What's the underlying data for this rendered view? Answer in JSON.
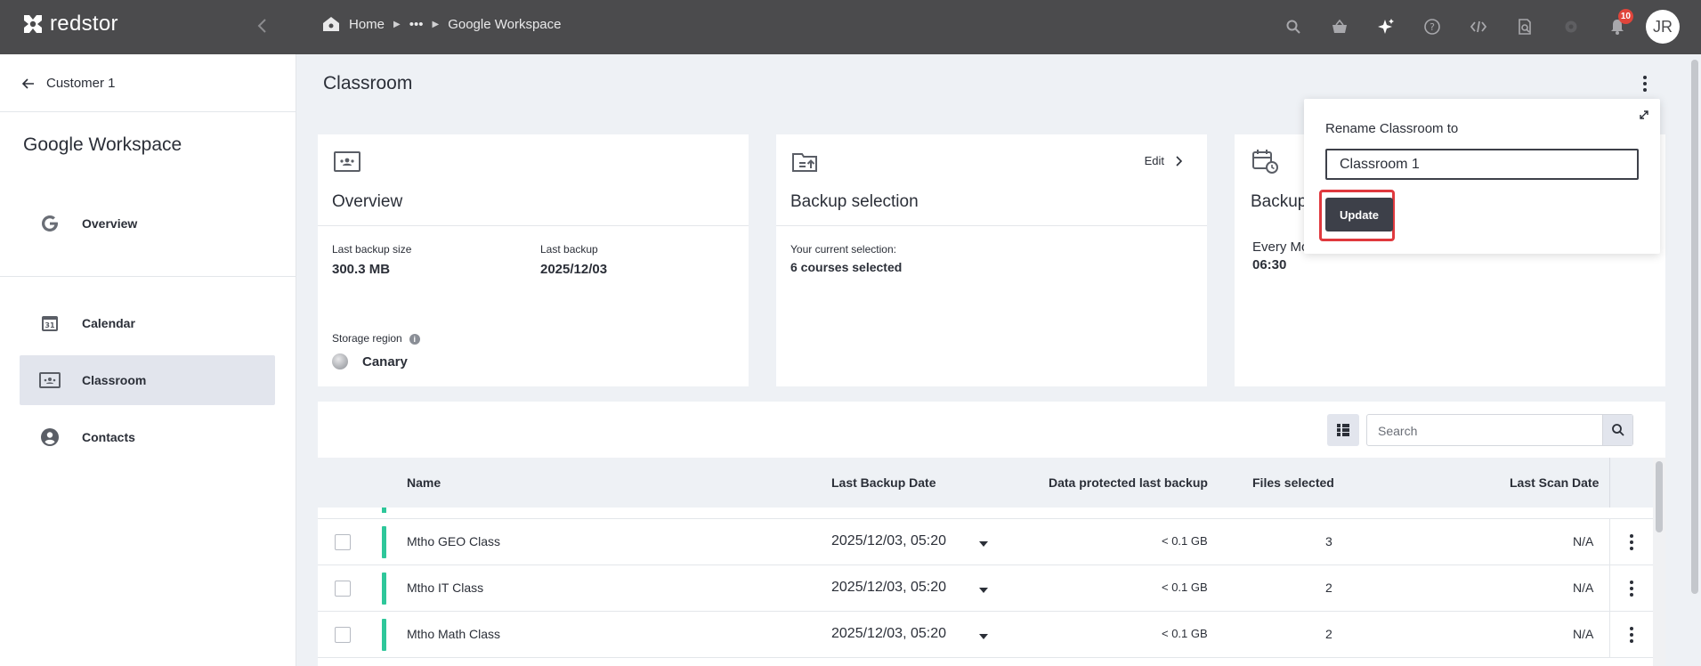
{
  "app": {
    "logo_text": "redstor"
  },
  "breadcrumb": {
    "home": "Home",
    "ellipsis": "•••",
    "current": "Google Workspace"
  },
  "topbar": {
    "notification_count": "10",
    "avatar_initials": "JR"
  },
  "sidebar": {
    "back_label": "Customer 1",
    "section_title": "Google Workspace",
    "items": [
      {
        "label": "Overview",
        "icon": "google-icon"
      },
      {
        "label": "Calendar",
        "icon": "calendar-icon"
      },
      {
        "label": "Classroom",
        "icon": "classroom-icon",
        "active": true
      },
      {
        "label": "Contacts",
        "icon": "contacts-icon"
      }
    ]
  },
  "page": {
    "title": "Classroom"
  },
  "cards": {
    "overview": {
      "title": "Overview",
      "last_backup_size_label": "Last backup size",
      "last_backup_size": "300.3 MB",
      "last_backup_label": "Last backup",
      "last_backup": "2025/12/03",
      "storage_region_label": "Storage region",
      "storage_region": "Canary"
    },
    "backup_selection": {
      "title": "Backup selection",
      "edit_label": "Edit",
      "current_selection_label": "Your current selection:",
      "current_selection": "6 courses selected"
    },
    "schedule": {
      "title": "Backup",
      "frequency": "Every Mo",
      "time": "06:30"
    }
  },
  "table": {
    "search_placeholder": "Search",
    "headers": {
      "name": "Name",
      "last_backup_date": "Last Backup Date",
      "data_protected": "Data protected last backup",
      "files_selected": "Files selected",
      "last_scan_date": "Last Scan Date"
    },
    "rows": [
      {
        "name": "Mtho GEO Class",
        "date": "2025/12/03, 05:20",
        "protected": "< 0.1 GB",
        "files": "3",
        "scan": "N/A"
      },
      {
        "name": "Mtho IT Class",
        "date": "2025/12/03, 05:20",
        "protected": "< 0.1 GB",
        "files": "2",
        "scan": "N/A"
      },
      {
        "name": "Mtho Math Class",
        "date": "2025/12/03, 05:20",
        "protected": "< 0.1 GB",
        "files": "2",
        "scan": "N/A"
      }
    ]
  },
  "rename_popover": {
    "label": "Rename Classroom to",
    "value": "Classroom 1",
    "button": "Update"
  },
  "colors": {
    "topbar": "#4b4b4d",
    "accent_green": "#2ec79a",
    "highlight_red": "#e0393e",
    "button_dark": "#3d4049"
  }
}
